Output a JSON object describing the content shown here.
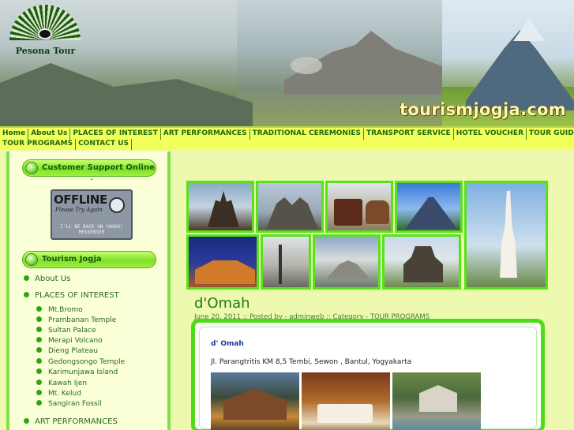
{
  "header": {
    "logo_text": "Pesona Tour",
    "site_url": "tourismjogja.com"
  },
  "nav": {
    "row1": [
      "Home",
      "About Us",
      "PLACES OF INTEREST",
      "ART PERFORMANCES",
      "TRADITIONAL CEREMONIES",
      "TRANSPORT SERVICE",
      "HOTEL VOUCHER",
      "TOUR GUIDE & LO"
    ],
    "row2": [
      "TOUR PROGRAMS",
      "CONTACT US"
    ]
  },
  "sidebar": {
    "support_title": "Customer Support Online",
    "offline_sign": {
      "big": "OFFLINE",
      "small": "Please Try Again",
      "tiny": "I'LL BE BACK ON YAHOO! MESSENGER"
    },
    "menu_title": "Tourism Jogja",
    "items": [
      "About Us",
      "PLACES OF INTEREST"
    ],
    "sub_items": [
      "Mt.Bromo",
      "Prambanan Temple",
      "Sultan Palace",
      "Merapi Volcano",
      "Dieng Plateau",
      "Gedongsongo Temple",
      "Karimunjawa Island",
      "Kawah Ijen",
      "Mt. Kelud",
      "Sangiran Fossil"
    ],
    "last_item": "ART PERFORMANCES"
  },
  "post": {
    "title": "d'Omah",
    "meta": "June 20, 2011 :: Posted by - adminweb :: Category - TOUR PROGRAMS",
    "heading": "d' Omah",
    "address": "Jl. Parangtritis KM 8,5 Tembi, Sewon , Bantul, Yogyakarta"
  }
}
